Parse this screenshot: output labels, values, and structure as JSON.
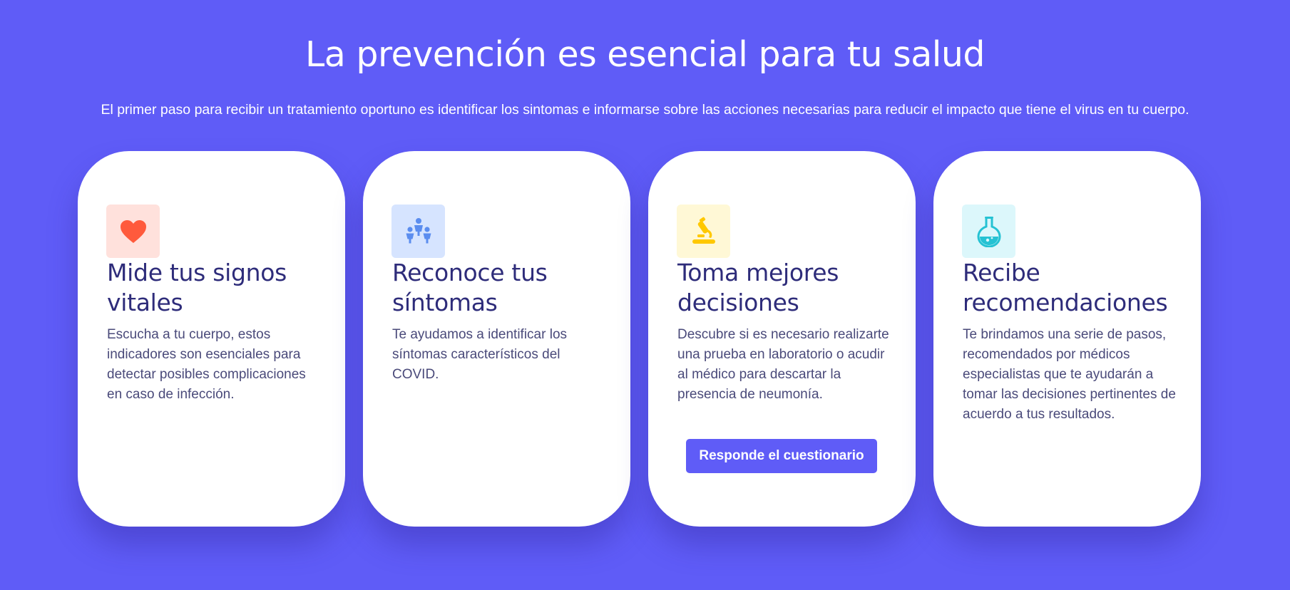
{
  "hero": {
    "title": "La prevención es esencial para tu salud",
    "subtitle": "El primer paso para recibir un tratamiento oportuno es identificar los sintomas e informarse sobre las acciones necesarias para reducir el impacto que tiene el virus en tu cuerpo."
  },
  "cards": [
    {
      "icon": "heart-icon",
      "title": "Mide tus signos vitales",
      "text": "Escucha a tu cuerpo, estos indicadores son esenciales para detectar posibles complicaciones en caso de infección."
    },
    {
      "icon": "people-icon",
      "title": "Reconoce tus síntomas",
      "text": "Te ayudamos a identificar los síntomas característicos del COVID."
    },
    {
      "icon": "microscope-icon",
      "title": "Toma mejores decisiones",
      "text": "Descubre si es necesario realizarte una prueba en laboratorio o acudir al médico para descartar la presencia de neumonía.",
      "button_label": "Responde el cuestionario"
    },
    {
      "icon": "flask-icon",
      "title": "Recibe recomendaciones",
      "text": "Te brindamos una serie de pasos, recomendados por médicos especialistas que te ayudarán a tomar las decisiones pertinentes de acuerdo a tus resultados."
    }
  ],
  "colors": {
    "background": "#5f5cf7",
    "card": "#ffffff",
    "heading": "#2e2c7a",
    "heart": "#ff5a3c",
    "people": "#5b8def",
    "microscope": "#ffc800",
    "flask": "#25c2d3"
  }
}
